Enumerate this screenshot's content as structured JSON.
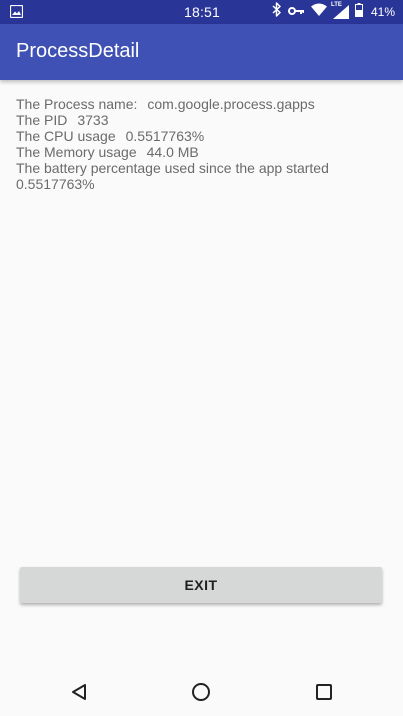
{
  "status_bar": {
    "time": "18:51",
    "battery_percent": "41%",
    "network_label": "LTE",
    "icons": [
      "image-notification-icon",
      "bluetooth-icon",
      "vpn-key-icon",
      "wifi-icon",
      "cellular-signal-icon",
      "battery-icon"
    ]
  },
  "app_bar": {
    "title": "ProcessDetail"
  },
  "process": {
    "name_label": "The Process name:",
    "name_value": "com.google.process.gapps",
    "pid_label": "The PID",
    "pid_value": "3733",
    "cpu_label": "The CPU usage",
    "cpu_value": "0.5517763%",
    "memory_label": "The Memory usage",
    "memory_value": "44.0 MB",
    "battery_label": "The battery percentage used since the app started",
    "battery_value": "0.5517763%"
  },
  "actions": {
    "exit_label": "EXIT"
  },
  "nav_bar": {
    "icons": [
      "back-icon",
      "home-icon",
      "recents-icon"
    ]
  },
  "colors": {
    "status_bar": "#2a3598",
    "app_bar": "#3f51b5",
    "background": "#fafafa",
    "button": "#d6d7d7",
    "text": "#6b6b6b"
  }
}
